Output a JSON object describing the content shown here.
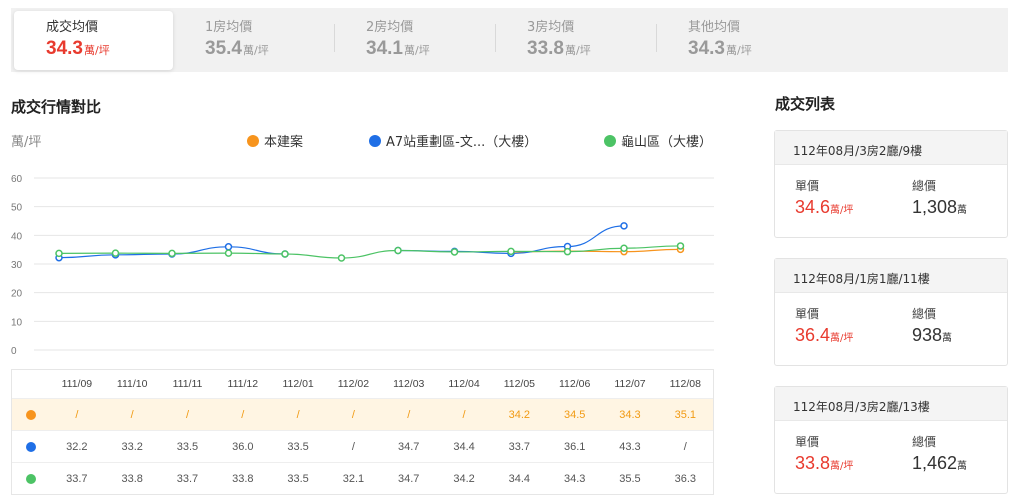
{
  "tabs": [
    {
      "label": "成交均價",
      "value": "34.3",
      "unit": "萬/坪"
    },
    {
      "label": "1房均價",
      "value": "35.4",
      "unit": "萬/坪"
    },
    {
      "label": "2房均價",
      "value": "34.1",
      "unit": "萬/坪"
    },
    {
      "label": "3房均價",
      "value": "33.8",
      "unit": "萬/坪"
    },
    {
      "label": "其他均價",
      "value": "34.3",
      "unit": "萬/坪"
    }
  ],
  "chart_heading": "成交行情對比",
  "list_heading": "成交列表",
  "chart_data": {
    "type": "line",
    "title": "成交行情對比",
    "ylabel": "萬/坪",
    "ylim": [
      0,
      60
    ],
    "yticks": [
      "0",
      "10",
      "20",
      "30",
      "40",
      "50",
      "60"
    ],
    "grid": true,
    "legend_position": "top-right",
    "categories": [
      "111/09",
      "111/10",
      "111/11",
      "111/12",
      "112/01",
      "112/02",
      "112/03",
      "112/04",
      "112/05",
      "112/06",
      "112/07",
      "112/08"
    ],
    "series": [
      {
        "name": "本建案",
        "color": "#f7941d",
        "values": [
          null,
          null,
          null,
          null,
          null,
          null,
          null,
          null,
          34.2,
          34.5,
          34.3,
          35.1
        ],
        "labels": [
          "/",
          "/",
          "/",
          "/",
          "/",
          "/",
          "/",
          "/",
          "34.2",
          "34.5",
          "34.3",
          "35.1"
        ]
      },
      {
        "name": "A7站重劃區-文...（大樓）",
        "color": "#1f6fe6",
        "values": [
          32.2,
          33.2,
          33.5,
          36.0,
          33.5,
          null,
          34.7,
          34.4,
          33.7,
          36.1,
          43.3,
          null
        ],
        "labels": [
          "32.2",
          "33.2",
          "33.5",
          "36.0",
          "33.5",
          "/",
          "34.7",
          "34.4",
          "33.7",
          "36.1",
          "43.3",
          "/"
        ]
      },
      {
        "name": "龜山區（大樓）",
        "color": "#4cc365",
        "values": [
          33.7,
          33.8,
          33.7,
          33.8,
          33.5,
          32.1,
          34.7,
          34.2,
          34.4,
          34.3,
          35.5,
          36.3
        ],
        "labels": [
          "33.7",
          "33.8",
          "33.7",
          "33.8",
          "33.5",
          "32.1",
          "34.7",
          "34.2",
          "34.4",
          "34.3",
          "35.5",
          "36.3"
        ]
      }
    ]
  },
  "transactions": [
    {
      "title": "112年08月/3房2廳/9樓",
      "unit_price_label": "單價",
      "unit_price": "34.6",
      "unit_price_unit": "萬/坪",
      "total_label": "總價",
      "total": "1,308",
      "total_unit": "萬"
    },
    {
      "title": "112年08月/1房1廳/11樓",
      "unit_price_label": "單價",
      "unit_price": "36.4",
      "unit_price_unit": "萬/坪",
      "total_label": "總價",
      "total": "938",
      "total_unit": "萬"
    },
    {
      "title": "112年08月/3房2廳/13樓",
      "unit_price_label": "單價",
      "unit_price": "33.8",
      "unit_price_unit": "萬/坪",
      "total_label": "總價",
      "total": "1,462",
      "total_unit": "萬"
    }
  ]
}
